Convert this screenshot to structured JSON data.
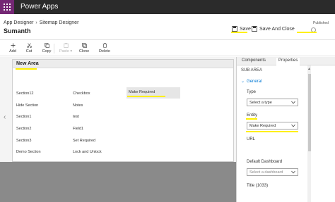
{
  "app": {
    "title": "Power Apps"
  },
  "header": {
    "breadcrumb": [
      "App Designer",
      "Sitemap Designer"
    ],
    "title": "Sumanth",
    "save_label": "Save",
    "save_close_label": "Save And Close",
    "status": "Published"
  },
  "toolbar": {
    "items": [
      {
        "label": "Add",
        "icon": "plus-icon",
        "enabled": true
      },
      {
        "label": "Cut",
        "icon": "scissors-icon",
        "enabled": true
      },
      {
        "label": "Copy",
        "icon": "copy-icon",
        "enabled": true
      },
      {
        "label": "Paste",
        "icon": "paste-icon",
        "enabled": false
      },
      {
        "label": "Clone",
        "icon": "clone-icon",
        "enabled": true
      },
      {
        "label": "Delete",
        "icon": "trash-icon",
        "enabled": true
      }
    ]
  },
  "canvas": {
    "area_title": "New Area",
    "rows": [
      {
        "group": "Section12",
        "subarea": "Checkbox",
        "extra": "Make Required"
      },
      {
        "group": "Hide Section",
        "subarea": "Notes"
      },
      {
        "group": "Section1",
        "subarea": "test"
      },
      {
        "group": "Section2",
        "subarea": "Field1"
      },
      {
        "group": "Section3",
        "subarea": "Set Required"
      },
      {
        "group": "Demo Section",
        "subarea": "Lock and Unlock"
      }
    ]
  },
  "panel": {
    "tabs": [
      "Components",
      "Properties"
    ],
    "active_tab": "Properties",
    "section_title": "SUB AREA",
    "general_label": "General",
    "fields": {
      "type_label": "Type",
      "type_value": "Select a type",
      "entity_label": "Entity",
      "entity_value": "Make Required",
      "url_label": "URL",
      "dashboard_label": "Default Dashboard",
      "dashboard_placeholder": "Select a dashboard",
      "title_label": "Title (1033)"
    }
  },
  "colors": {
    "brand": "#742774",
    "appbar": "#2b2b2b",
    "highlight": "#fff000",
    "link": "#0078d4",
    "canvas_bottom": "#8a8a8a"
  }
}
